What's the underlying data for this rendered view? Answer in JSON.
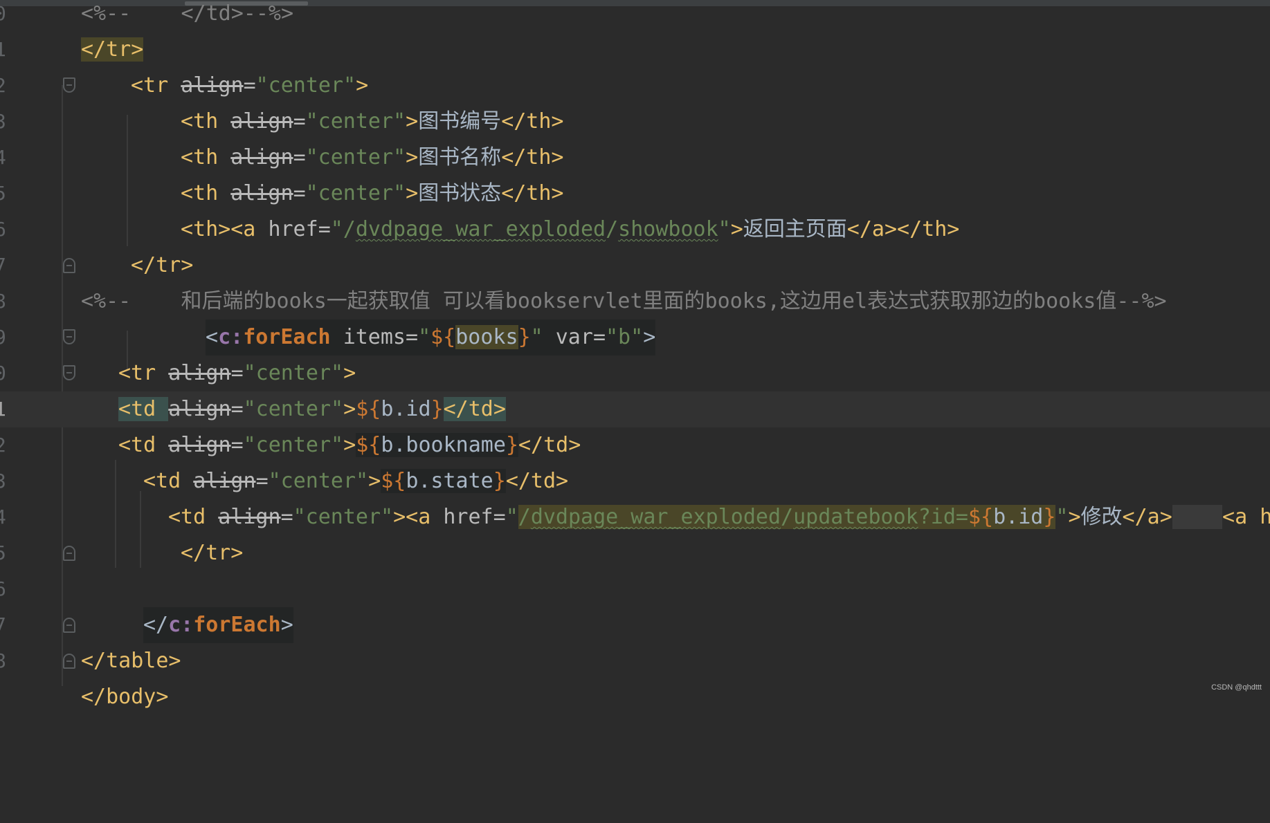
{
  "editor": {
    "line_numbers": [
      "0",
      "1",
      "2",
      "3",
      "4",
      "5",
      "6",
      "7",
      "8",
      "9",
      "0",
      "1",
      "2",
      "3",
      "4",
      "5",
      "6",
      "7",
      "8"
    ],
    "lines": {
      "l0_open": "<%--",
      "l0_text": "    </td>--%>",
      "l1_text": "</tr>",
      "l2_tag_open": "<tr ",
      "l2_attr": "align",
      "l2_eq": "=",
      "l2_value": "\"center\"",
      "l2_tag_close": ">",
      "l3_tag_open": "<th ",
      "l3_attr": "align",
      "l3_eq": "=",
      "l3_value": "\"center\"",
      "l3_gt": ">",
      "l3_text": "图书编号",
      "l3_end_tag": "</th>",
      "l4_tag_open": "<th ",
      "l4_attr": "align",
      "l4_eq": "=",
      "l4_value": "\"center\"",
      "l4_gt": ">",
      "l4_text": "图书名称",
      "l4_end_tag": "</th>",
      "l5_tag_open": "<th ",
      "l5_attr": "align",
      "l5_eq": "=",
      "l5_value": "\"center\"",
      "l5_gt": ">",
      "l5_text": "图书状态",
      "l5_end_tag": "</th>",
      "l6_tag_open": "<th><a ",
      "l6_attr": "href",
      "l6_eq": "=",
      "l6_q1": "\"/",
      "l6_url1": "dvdpage_war_exploded",
      "l6_slash": "/",
      "l6_url2": "showbook",
      "l6_q2": "\"",
      "l6_gt": ">",
      "l6_text": "返回主页面",
      "l6_end_tag": "</a></th>",
      "l7_text": "</tr>",
      "l8_open": "<%--",
      "l8_text": "    和后端的books一起获取值 可以看bookservlet里面的books,这边用el表达式获取那边的books值--%>",
      "l9_lt": "<",
      "l9_ns": "c:",
      "l9_kw": "forEach",
      "l9_sp": " ",
      "l9_attr": "items",
      "l9_eq": "=",
      "l9_q1": "\"",
      "l9_el_open": "${",
      "l9_var": "books",
      "l9_el_close": "}",
      "l9_q2": "\"",
      "l9_attr2": " var",
      "l9_eq2": "=",
      "l9_value2": "\"b\"",
      "l9_gt": ">",
      "l10_tag_open": "<tr ",
      "l10_attr": "align",
      "l10_eq": "=",
      "l10_value": "\"center\"",
      "l10_gt": ">",
      "l11_lt": "<",
      "l11_tag": "td ",
      "l11_attr": "align",
      "l11_eq": "=",
      "l11_value": "\"center\"",
      "l11_gt": ">",
      "l11_el_open": "${",
      "l11_expr": "b.id",
      "l11_el_close": "}",
      "l11_end_tag": "</td>",
      "l12_tag_open": "<td ",
      "l12_attr": "align",
      "l12_eq": "=",
      "l12_value": "\"center\"",
      "l12_gt": ">",
      "l12_el_open": "${",
      "l12_expr": "b.bookname",
      "l12_el_close": "}",
      "l12_end_tag": "</td>",
      "l13_tag_open": "<td ",
      "l13_attr": "align",
      "l13_eq": "=",
      "l13_value": "\"center\"",
      "l13_gt": ">",
      "l13_el_open": "${",
      "l13_expr": "b.state",
      "l13_el_close": "}",
      "l13_end_tag": "</td>",
      "l14_tag_open": "<td ",
      "l14_attr": "align",
      "l14_eq": "=",
      "l14_value": "\"center\"",
      "l14_gt": "><a ",
      "l14_attr2": "href",
      "l14_eq2": "=",
      "l14_q1": "\"",
      "l14_slash1": "/",
      "l14_url1": "dvdpage_war_exploded",
      "l14_slash2": "/",
      "l14_url2": "updatebook",
      "l14_query": "?id=",
      "l14_el_open": "${",
      "l14_expr": "b.id",
      "l14_el_close": "}",
      "l14_q2": "\"",
      "l14_gt2": ">",
      "l14_text": "修改",
      "l14_end_tag": "</a>",
      "l14_space": "    ",
      "l14_next": "<a h",
      "l15_text": "</tr>",
      "l17_lt": "</",
      "l17_ns": "c:",
      "l17_kw": "forEach",
      "l17_gt": ">",
      "l18_text": "</table>",
      "l19_text": "</body>"
    }
  },
  "watermark": "CSDN @qhdttt",
  "theme": {
    "background": "#2b2b2b",
    "tag": "#e8bf6a",
    "string": "#6a8759",
    "el_delimiter": "#cc7832",
    "comment": "#808080",
    "namespace": "#9876aa"
  }
}
